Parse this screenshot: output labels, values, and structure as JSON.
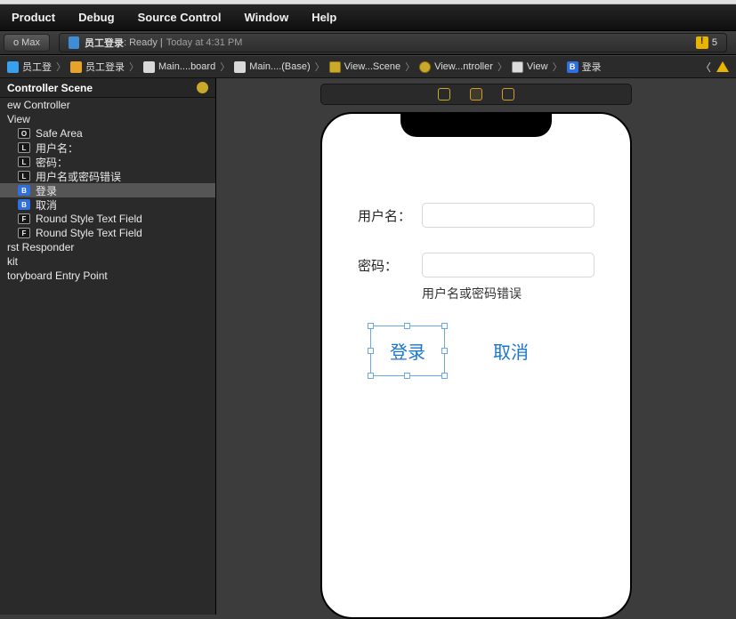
{
  "menubar": {
    "items": [
      "Product",
      "Debug",
      "Source Control",
      "Window",
      "Help"
    ]
  },
  "toolbar": {
    "scheme": "o Max",
    "status_app": "员工登录",
    "status_state": ": Ready | ",
    "status_time": "Today at 4:31 PM",
    "warn_count": "5"
  },
  "pathbar": {
    "crumbs": [
      {
        "icon": "doc",
        "label": "员工登"
      },
      {
        "icon": "fold",
        "label": "员工登录"
      },
      {
        "icon": "sb",
        "label": "Main....board"
      },
      {
        "icon": "sb",
        "label": "Main....(Base)"
      },
      {
        "icon": "scene",
        "label": "View...Scene"
      },
      {
        "icon": "vc",
        "label": "View...ntroller"
      },
      {
        "icon": "view",
        "label": "View"
      },
      {
        "icon": "btn",
        "label": "登录"
      }
    ]
  },
  "outline": {
    "header": "Controller Scene",
    "rows": [
      {
        "lvl": 0,
        "badge": "",
        "label": "ew Controller"
      },
      {
        "lvl": 1,
        "badge": "",
        "label": "View"
      },
      {
        "lvl": 2,
        "badge": "O",
        "label": "Safe Area"
      },
      {
        "lvl": 2,
        "badge": "L",
        "label": "用户名："
      },
      {
        "lvl": 2,
        "badge": "L",
        "label": "密码："
      },
      {
        "lvl": 2,
        "badge": "L",
        "label": "用户名或密码错误"
      },
      {
        "lvl": 2,
        "badge": "B",
        "label": "登录",
        "selected": true
      },
      {
        "lvl": 2,
        "badge": "B",
        "label": "取消"
      },
      {
        "lvl": 2,
        "badge": "F",
        "label": "Round Style Text Field"
      },
      {
        "lvl": 2,
        "badge": "F",
        "label": "Round Style Text Field"
      },
      {
        "lvl": 0,
        "badge": "",
        "label": "rst Responder"
      },
      {
        "lvl": 0,
        "badge": "",
        "label": "kit"
      },
      {
        "lvl": 0,
        "badge": "",
        "label": "toryboard Entry Point"
      }
    ]
  },
  "phone": {
    "username_label": "用户名：",
    "password_label": "密码：",
    "error_label": "用户名或密码错误",
    "login_button": "登录",
    "cancel_button": "取消"
  }
}
